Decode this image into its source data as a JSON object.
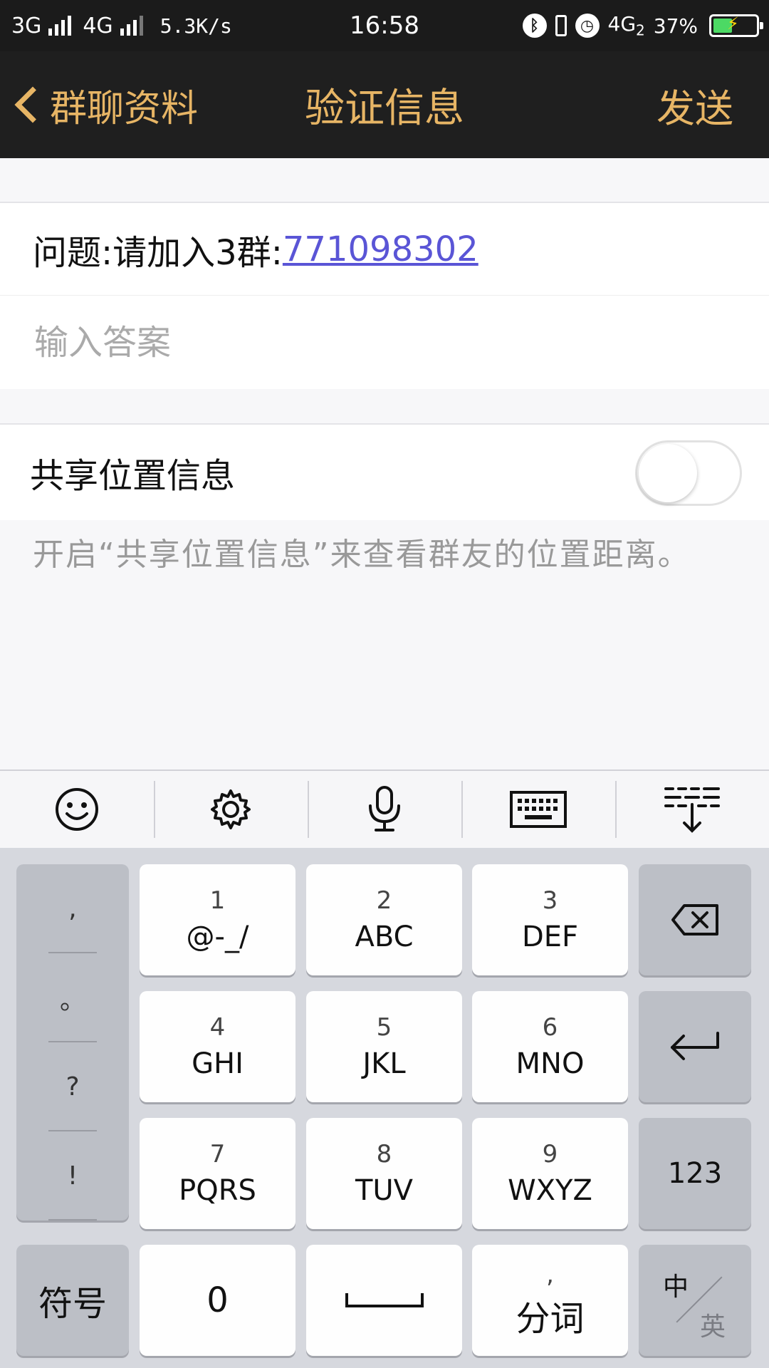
{
  "status_bar": {
    "network1": "3G",
    "network2": "4G",
    "net_speed": "5.3K/s",
    "time": "16:58",
    "network3": "4G",
    "network3_sub": "2",
    "battery": "37%"
  },
  "nav": {
    "back_label": "群聊资料",
    "title": "验证信息",
    "send_label": "发送"
  },
  "question": {
    "prefix": "问题:请加入3群:",
    "link": "771098302"
  },
  "answer": {
    "placeholder": "输入答案"
  },
  "share_location": {
    "label": "共享位置信息",
    "enabled": false,
    "hint": "开启“共享位置信息”来查看群友的位置距离。"
  },
  "keyboard": {
    "punctuation": [
      ",",
      "。",
      "?",
      "!"
    ],
    "keys": [
      {
        "num": "1",
        "letters": "@-_/"
      },
      {
        "num": "2",
        "letters": "ABC"
      },
      {
        "num": "3",
        "letters": "DEF"
      },
      {
        "num": "4",
        "letters": "GHI"
      },
      {
        "num": "5",
        "letters": "JKL"
      },
      {
        "num": "6",
        "letters": "MNO"
      },
      {
        "num": "7",
        "letters": "PQRS"
      },
      {
        "num": "8",
        "letters": "TUV"
      },
      {
        "num": "9",
        "letters": "WXYZ"
      }
    ],
    "num_mode_label": "123",
    "symbols_label": "符号",
    "zero_label": "0",
    "segment_mark": ",",
    "segment_label": "分词",
    "lang_main": "中",
    "lang_alt": "英"
  },
  "colors": {
    "accent": "#e7b565",
    "link": "#5a55d6",
    "toggle_off": "#ffffff"
  }
}
